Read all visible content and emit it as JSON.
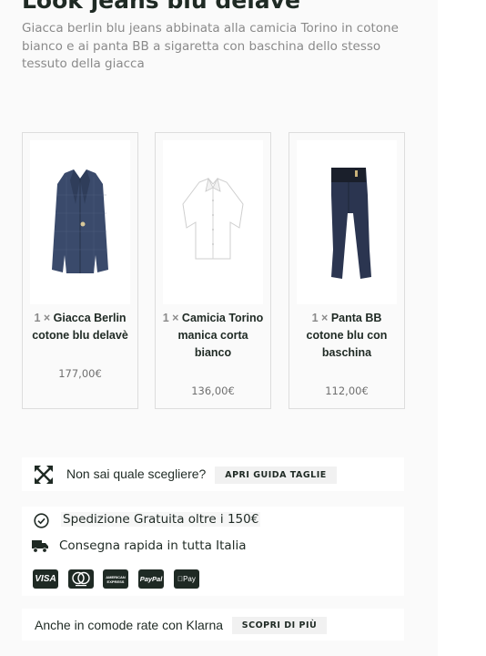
{
  "look": {
    "title": "Look jeans blu delavè",
    "description": "Giacca berlin blu jeans abbinata alla camicia Torino in cotone bianco e ai panta BB a sigaretta con baschina dello stesso tessuto della giacca"
  },
  "products": [
    {
      "qty": "1 ×",
      "name": "Giacca Berlin cotone blu delavè",
      "price": "177,00€",
      "image": "jacket-image"
    },
    {
      "qty": "1 ×",
      "name": "Camicia Torino manica corta bianco",
      "price": "136,00€",
      "image": "shirt-image"
    },
    {
      "qty": "1 ×",
      "name": "Panta BB cotone blu con baschina",
      "price": "112,00€",
      "image": "pants-image"
    }
  ],
  "size_guide": {
    "icon": "expand-arrows-icon",
    "text": "Non sai quale scegliere?",
    "button": "APRI GUIDA TAGLIE"
  },
  "shipping": {
    "free_icon": "check-circle-icon",
    "free_text": "Spedizione Gratuita oltre i 150€",
    "fast_icon": "truck-icon",
    "fast_text": "Consegna rapida in tutta Italia"
  },
  "payments": [
    {
      "label": "VISA",
      "icon": "visa-icon"
    },
    {
      "label": "",
      "icon": "mastercard-icon"
    },
    {
      "label": "AMERICAN EXPRESS",
      "icon": "amex-icon"
    },
    {
      "label": "PayPal",
      "icon": "paypal-icon"
    },
    {
      "label": "Pay",
      "icon": "apple-pay-icon"
    }
  ],
  "klarna": {
    "text": "Anche in comode rate con Klarna",
    "button": "SCOPRI DI PIÙ"
  },
  "colors": {
    "text_dark": "#1f2a24",
    "text_muted": "#8a8a8a",
    "panel_bg": "#fafafa",
    "pill_bg": "#f1f1f1",
    "jacket": "#3a4a6b",
    "pants": "#2b3550"
  }
}
